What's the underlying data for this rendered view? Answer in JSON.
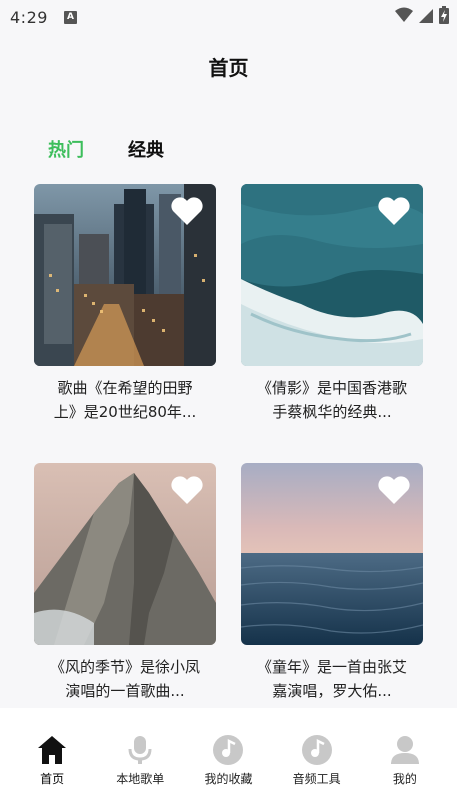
{
  "status_bar": {
    "time": "4:29",
    "notification_badge": "A"
  },
  "header": {
    "title": "首页"
  },
  "tabs": [
    {
      "label": "热门",
      "active": true
    },
    {
      "label": "经典",
      "active": false
    }
  ],
  "cards": [
    {
      "text": "歌曲《在希望的田野上》是20世纪80年...",
      "image": "city-night-skyline",
      "favorited": false
    },
    {
      "text": "《倩影》是中国香港歌手蔡枫华的经典...",
      "image": "ocean-waves-aerial",
      "favorited": false
    },
    {
      "text": "《风的季节》是徐小凤演唱的一首歌曲...",
      "image": "rocky-mountain-peak",
      "favorited": false
    },
    {
      "text": "《童年》是一首由张艾嘉演唱，罗大佑...",
      "image": "sea-at-dusk",
      "favorited": false
    }
  ],
  "bottom_nav": [
    {
      "label": "首页",
      "icon": "home-icon",
      "active": true
    },
    {
      "label": "本地歌单",
      "icon": "microphone-icon",
      "active": false
    },
    {
      "label": "我的收藏",
      "icon": "music-disc-icon",
      "active": false
    },
    {
      "label": "音频工具",
      "icon": "music-disc-icon",
      "active": false
    },
    {
      "label": "我的",
      "icon": "user-icon",
      "active": false
    }
  ],
  "colors": {
    "accent": "#3dbe5c",
    "background": "#f7f7f9",
    "nav_inactive_icon": "#c8c8c8"
  }
}
